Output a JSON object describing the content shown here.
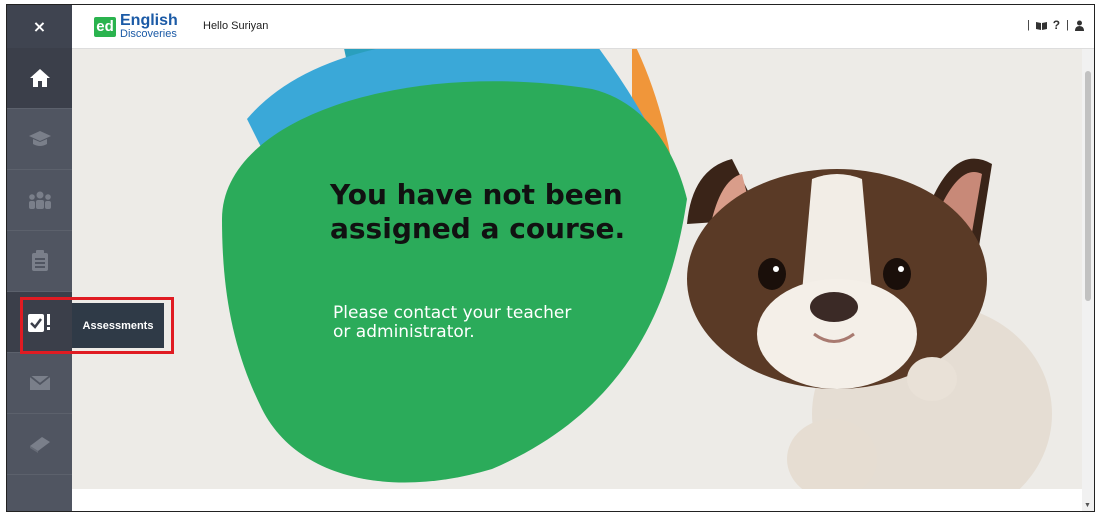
{
  "sidebar": {
    "close_label": "×",
    "items": [
      {
        "name": "home",
        "icon": "home-icon"
      },
      {
        "name": "courses",
        "icon": "graduation-cap-icon"
      },
      {
        "name": "community",
        "icon": "users-icon"
      },
      {
        "name": "tasks",
        "icon": "clipboard-icon"
      },
      {
        "name": "assessments",
        "icon": "assessment-icon",
        "tooltip": "Assessments"
      },
      {
        "name": "messages",
        "icon": "envelope-icon"
      },
      {
        "name": "library",
        "icon": "book-icon"
      }
    ]
  },
  "header": {
    "logo_short": "ed",
    "logo_title": "English",
    "logo_subtitle": "Discoveries",
    "greeting": "Hello Suriyan",
    "separator": "|"
  },
  "main": {
    "headline": "You have not been assigned a course.",
    "subtext": "Please contact your teacher or administrator."
  },
  "colors": {
    "sidebar": "#505561",
    "accent_green": "#2bab5a",
    "logo_blue": "#1b5aa6",
    "highlight_red": "#e01b22"
  }
}
